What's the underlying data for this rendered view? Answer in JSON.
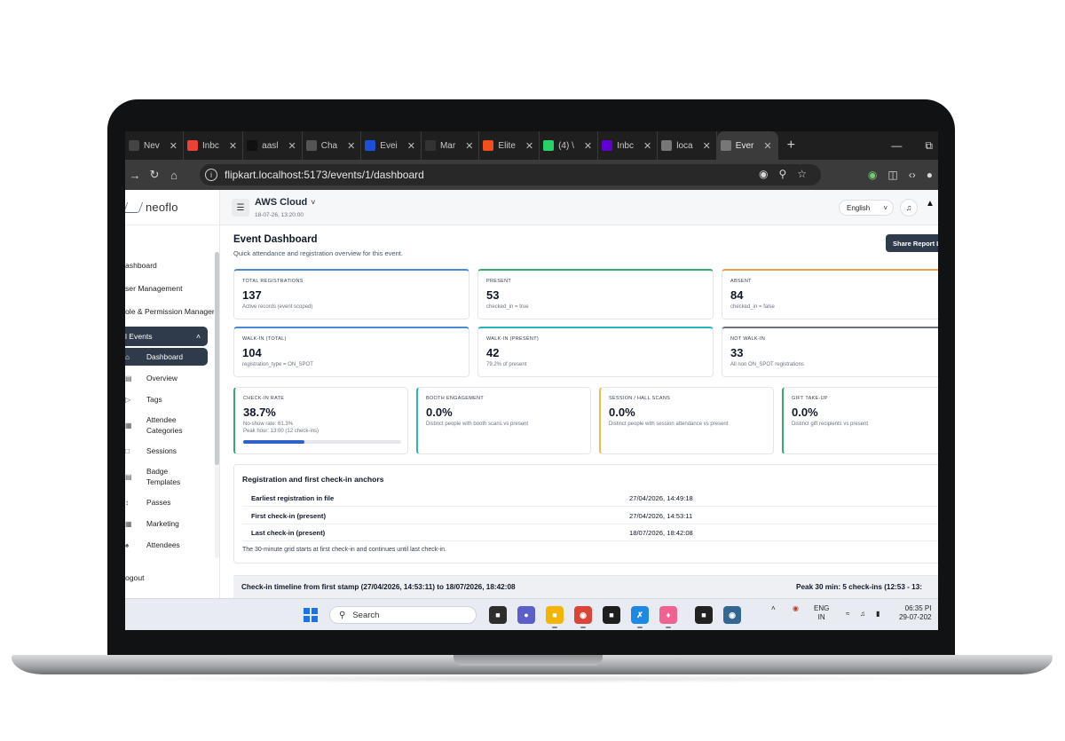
{
  "browser": {
    "tabs": [
      {
        "label": "Nev",
        "icon": "tab-favicon-icon",
        "color": "#444"
      },
      {
        "label": "Inbc",
        "icon": "gmail-icon",
        "color": "#ea4335"
      },
      {
        "label": "aasl",
        "icon": "github-icon",
        "color": "#111"
      },
      {
        "label": "Cha",
        "icon": "chatgpt-icon",
        "color": "#555"
      },
      {
        "label": "Evei",
        "icon": "tab-favicon-icon",
        "color": "#1d4ed8"
      },
      {
        "label": "Mar",
        "icon": "m-icon",
        "color": "#333"
      },
      {
        "label": "Elite",
        "icon": "figma-icon",
        "color": "#f24e1e"
      },
      {
        "label": "(4) \\",
        "icon": "whatsapp-icon",
        "color": "#25d366"
      },
      {
        "label": "Inbc",
        "icon": "yahoo-mail-icon",
        "color": "#6001d2"
      },
      {
        "label": "loca",
        "icon": "globe-icon",
        "color": "#777"
      },
      {
        "label": "Ever",
        "icon": "globe-icon",
        "color": "#777",
        "active": true
      }
    ],
    "url": "flipkart.localhost:5173/events/1/dashboard"
  },
  "sidebar": {
    "logo": "neoflo",
    "items": [
      "ashboard",
      "ser Management",
      "ole & Permission Manageme"
    ],
    "group_label": "l Events",
    "sub_items": [
      {
        "label": "Dashboard",
        "icon": "home-icon",
        "active": true
      },
      {
        "label": "Overview",
        "icon": "document-icon"
      },
      {
        "label": "Tags",
        "icon": "tag-icon"
      },
      {
        "label": "Attendee Categories",
        "icon": "grid-icon"
      },
      {
        "label": "Sessions",
        "icon": "calendar-icon"
      },
      {
        "label": "Badge Templates",
        "icon": "template-icon"
      },
      {
        "label": "Passes",
        "icon": "pass-icon"
      },
      {
        "label": "Marketing",
        "icon": "megaphone-icon"
      },
      {
        "label": "Attendees",
        "icon": "users-icon"
      }
    ],
    "logout": "ogout"
  },
  "topbar": {
    "event_name": "AWS Cloud",
    "event_date": "18-07-26, 13:20:00",
    "language": "English"
  },
  "dashboard": {
    "title": "Event Dashboard",
    "subtitle": "Quick attendance and registration overview for this event.",
    "share_button": "Share Report L",
    "row1": [
      {
        "label": "TOTAL REGISTRATIONS",
        "value": "137",
        "note": "Active records (event scoped)",
        "accent": "#4a8ad6"
      },
      {
        "label": "PRESENT",
        "value": "53",
        "note": "checked_in = true",
        "accent": "#3aa76d"
      },
      {
        "label": "ABSENT",
        "value": "84",
        "note": "checked_in = false",
        "accent": "#e8a24a"
      }
    ],
    "row2": [
      {
        "label": "WALK-IN (TOTAL)",
        "value": "104",
        "note": "registration_type = ON_SPOT",
        "accent": "#4a8ad6"
      },
      {
        "label": "WALK-IN (PRESENT)",
        "value": "42",
        "note": "79.2% of present",
        "accent": "#2bb3c0"
      },
      {
        "label": "NOT WALK-IN",
        "value": "33",
        "note": "All non ON_SPOT registrations",
        "accent": "#6b7280"
      }
    ],
    "row3": [
      {
        "label": "CHECK-IN RATE",
        "value": "38.7%",
        "note": "No-show rate: 61.3%",
        "note2": "Peak hour: 13:00 (12 check-ins)",
        "accent": "#3aa76d",
        "progress": 0.387
      },
      {
        "label": "BOOTH ENGAGEMENT",
        "value": "0.0%",
        "note": "Distinct people with booth scans vs present",
        "accent": "#2bb3c0"
      },
      {
        "label": "SESSION / HALL SCANS",
        "value": "0.0%",
        "note": "Distinct people with session attendance vs present",
        "accent": "#e8c04a"
      },
      {
        "label": "GIFT TAKE-UP",
        "value": "0.0%",
        "note": "Distinct gift recipients vs present",
        "accent": "#3aa76d"
      }
    ],
    "anchors": {
      "title": "Registration and first check-in anchors",
      "rows": [
        {
          "key": "Earliest registration in file",
          "value": "27/04/2026, 14:49:18"
        },
        {
          "key": "First check-in (present)",
          "value": "27/04/2026, 14:53:11"
        },
        {
          "key": "Last check-in (present)",
          "value": "18/07/2026, 18:42:08"
        }
      ],
      "footer": "The 30-minute grid starts at first check-in and continues until last check-in."
    },
    "timeline": {
      "left": "Check-in timeline from first stamp (27/04/2026, 14:53:11) to 18/07/2026, 18:42:08",
      "right": "Peak 30 min: 5 check-ins (12:53 - 13:"
    }
  },
  "taskbar": {
    "search": "Search",
    "lang_top": "ENG",
    "lang_bottom": "IN",
    "time": "06:35 PI",
    "date": "29-07-202"
  }
}
